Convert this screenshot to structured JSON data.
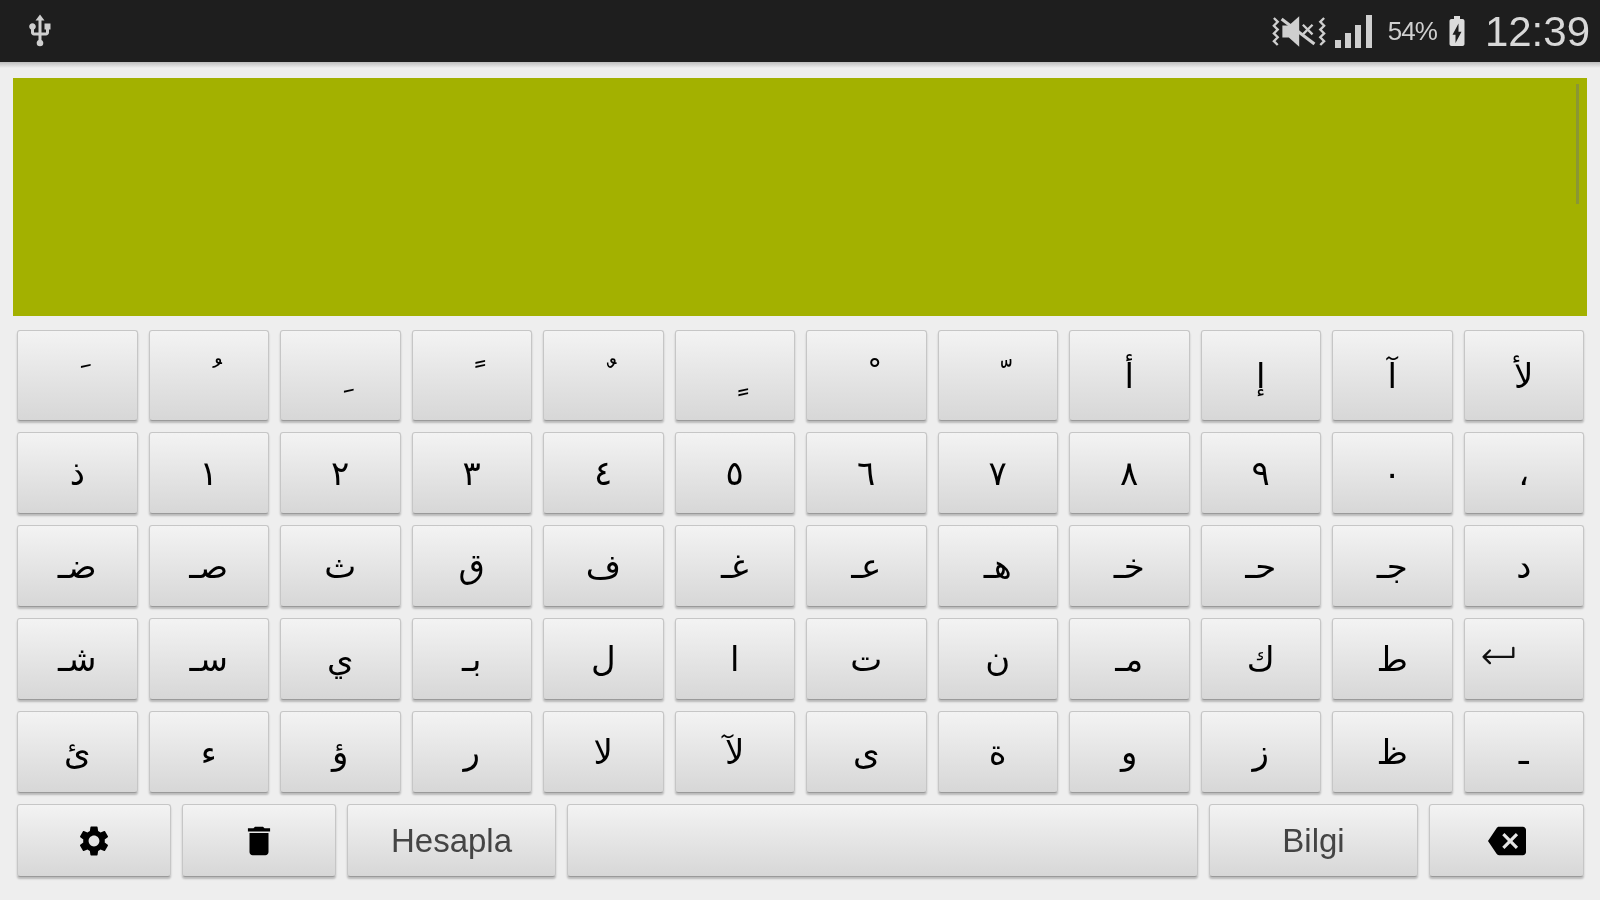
{
  "status_bar": {
    "battery": "54%",
    "time": "12:39"
  },
  "keyboard": {
    "rows": [
      [
        {
          "kind": "char",
          "label": "َ"
        },
        {
          "kind": "char",
          "label": "ُ"
        },
        {
          "kind": "char",
          "label": "ِ"
        },
        {
          "kind": "char",
          "label": "ً"
        },
        {
          "kind": "char",
          "label": "ٌ"
        },
        {
          "kind": "char",
          "label": "ٍ"
        },
        {
          "kind": "char",
          "label": "ْ"
        },
        {
          "kind": "char",
          "label": "ّ"
        },
        {
          "kind": "char",
          "label": "أ"
        },
        {
          "kind": "char",
          "label": "إ"
        },
        {
          "kind": "char",
          "label": "آ"
        },
        {
          "kind": "char",
          "label": "لأ"
        }
      ],
      [
        {
          "kind": "char",
          "label": "ذ"
        },
        {
          "kind": "char",
          "label": "١"
        },
        {
          "kind": "char",
          "label": "٢"
        },
        {
          "kind": "char",
          "label": "٣"
        },
        {
          "kind": "char",
          "label": "٤"
        },
        {
          "kind": "char",
          "label": "٥"
        },
        {
          "kind": "char",
          "label": "٦"
        },
        {
          "kind": "char",
          "label": "٧"
        },
        {
          "kind": "char",
          "label": "٨"
        },
        {
          "kind": "char",
          "label": "٩"
        },
        {
          "kind": "char",
          "label": "٠"
        },
        {
          "kind": "char",
          "label": "،"
        }
      ],
      [
        {
          "kind": "char",
          "label": "ضـ"
        },
        {
          "kind": "char",
          "label": "صـ"
        },
        {
          "kind": "char",
          "label": "ث"
        },
        {
          "kind": "char",
          "label": "ق"
        },
        {
          "kind": "char",
          "label": "ف"
        },
        {
          "kind": "char",
          "label": "غـ"
        },
        {
          "kind": "char",
          "label": "عـ"
        },
        {
          "kind": "char",
          "label": "هـ"
        },
        {
          "kind": "char",
          "label": "خـ"
        },
        {
          "kind": "char",
          "label": "حـ"
        },
        {
          "kind": "char",
          "label": "جـ"
        },
        {
          "kind": "char",
          "label": "د"
        }
      ],
      [
        {
          "kind": "char",
          "label": "شـ"
        },
        {
          "kind": "char",
          "label": "سـ"
        },
        {
          "kind": "char",
          "label": "ي"
        },
        {
          "kind": "char",
          "label": "بـ"
        },
        {
          "kind": "char",
          "label": "ل"
        },
        {
          "kind": "char",
          "label": "ا"
        },
        {
          "kind": "char",
          "label": "ت"
        },
        {
          "kind": "char",
          "label": "ن"
        },
        {
          "kind": "char",
          "label": "مـ"
        },
        {
          "kind": "char",
          "label": "ك"
        },
        {
          "kind": "char",
          "label": "ط"
        },
        {
          "kind": "return"
        }
      ],
      [
        {
          "kind": "char",
          "label": "ئ"
        },
        {
          "kind": "char",
          "label": "ء"
        },
        {
          "kind": "char",
          "label": "ؤ"
        },
        {
          "kind": "char",
          "label": "ر"
        },
        {
          "kind": "char",
          "label": "لا"
        },
        {
          "kind": "char",
          "label": "لآ"
        },
        {
          "kind": "char",
          "label": "ى"
        },
        {
          "kind": "char",
          "label": "ة"
        },
        {
          "kind": "char",
          "label": "و"
        },
        {
          "kind": "char",
          "label": "ز"
        },
        {
          "kind": "char",
          "label": "ظ"
        },
        {
          "kind": "char",
          "label": "ـ"
        }
      ]
    ],
    "bottom_row": [
      {
        "kind": "settings"
      },
      {
        "kind": "clear"
      },
      {
        "kind": "label",
        "label": "Hesapla"
      },
      {
        "kind": "space"
      },
      {
        "kind": "label",
        "label": "Bilgi"
      },
      {
        "kind": "backspace"
      }
    ]
  }
}
